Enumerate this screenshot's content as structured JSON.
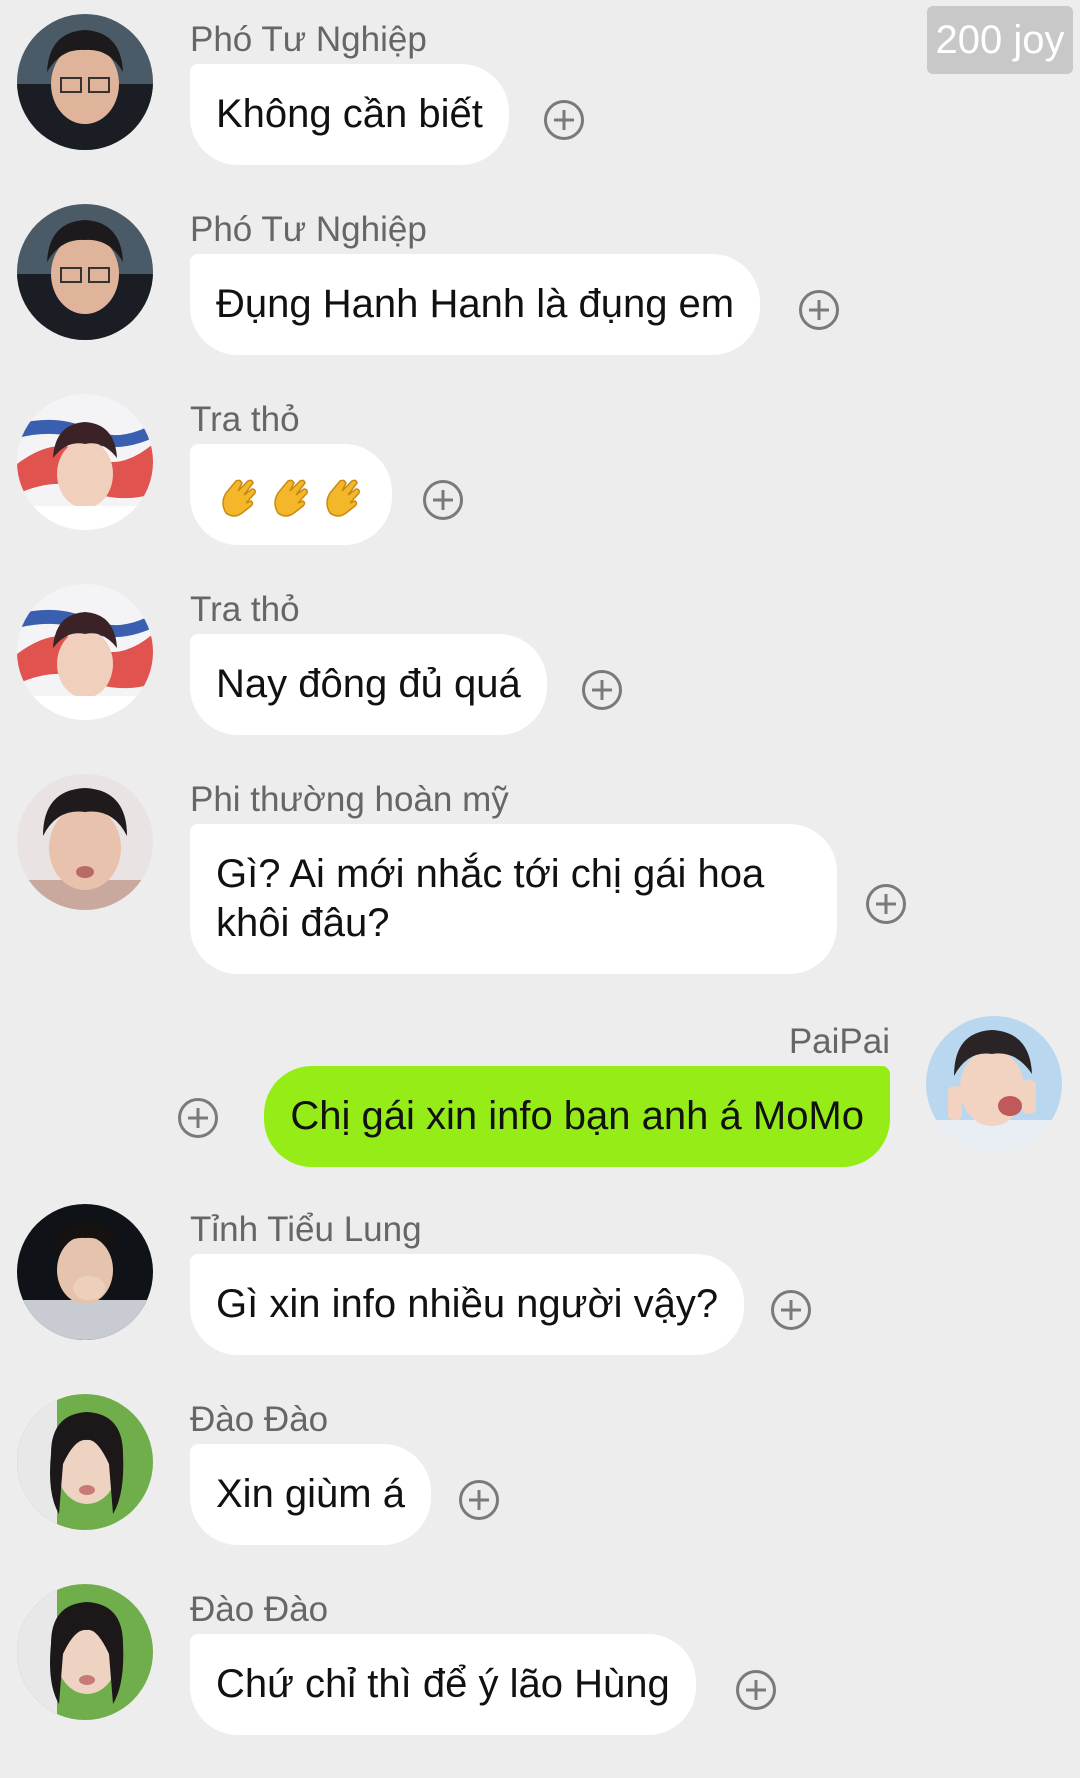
{
  "badge": {
    "joy": "200 joy"
  },
  "messages": [
    {
      "sender": "Phó Tư Nghiệp",
      "text": "Không cần biết"
    },
    {
      "sender": "Phó Tư Nghiệp",
      "text": "Đụng Hanh Hanh là đụng em"
    },
    {
      "sender": "Tra thỏ",
      "emoji": [
        "clapping-hands",
        "clapping-hands",
        "clapping-hands"
      ]
    },
    {
      "sender": "Tra thỏ",
      "text": "Nay đông đủ quá"
    },
    {
      "sender": "Phi thường hoàn mỹ",
      "text": "Gì? Ai mới nhắc tới chị gái hoa khôi đâu?"
    },
    {
      "sender": "PaiPai",
      "text": "Chị gái xin info bạn anh á MoMo"
    },
    {
      "sender": "Tỉnh Tiểu Lung",
      "text": "Gì xin info nhiều người vậy?"
    },
    {
      "sender": "Đào Đào",
      "text": "Xin giùm á"
    },
    {
      "sender": "Đào Đào",
      "text": "Chứ chỉ thì để ý lão Hùng"
    }
  ],
  "colors": {
    "background": "#ededed",
    "incoming_bubble": "#ffffff",
    "outgoing_bubble": "#95ec17",
    "badge": "#c8c8c8"
  },
  "icons": {
    "add": "plus-circle-icon",
    "emoji": "clapping-hands-icon"
  }
}
